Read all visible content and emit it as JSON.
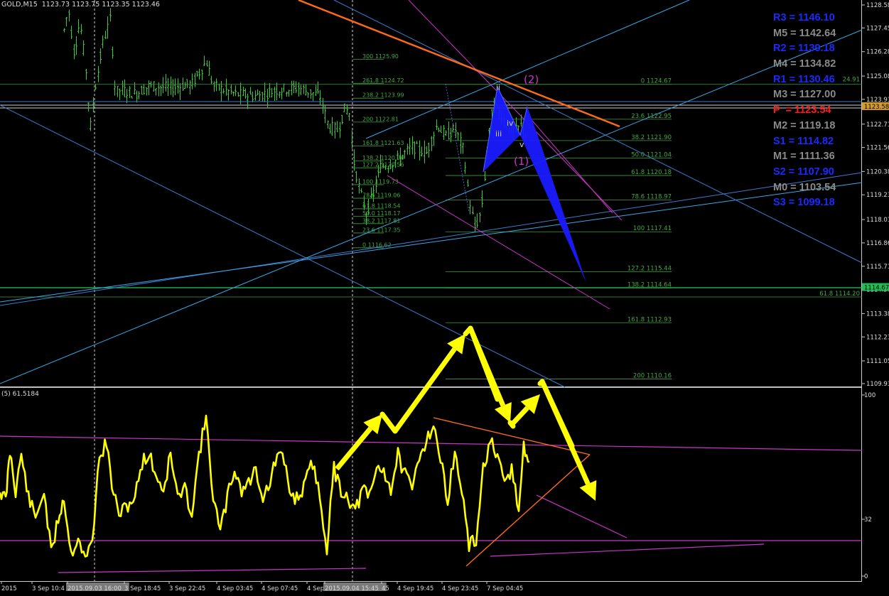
{
  "header": {
    "symbol": "GOLD,M15",
    "ohlc": "1123.73 1123.75 1123.35 1123.46"
  },
  "indicator": {
    "label": "(5) 61.5184"
  },
  "price_axis": {
    "ticks": [
      "1128.58",
      "1127.45",
      "1126.28",
      "1125.08",
      "1123.93",
      "1122.71",
      "1121.56",
      "1120.38",
      "1119.23",
      "1118.01",
      "1116.86",
      "1115.71",
      "1114.56",
      "1113.38",
      "1112.23",
      "1111.05",
      "1109.93"
    ],
    "current_price": "1123.58",
    "marked_price": "1114.67",
    "current_color": "#d29a2a",
    "marked_color": "#22bb55"
  },
  "indicator_axis": {
    "ticks": [
      "100",
      "32",
      "0"
    ]
  },
  "time_axis": {
    "labels": [
      "2015",
      "3 Sep 10:4",
      "2015.09.03 16:00",
      "3 Sep 18:45",
      "3 Sep 22:45",
      "4 Sep 03:45",
      "4 Sep 07:45",
      "4 Sep",
      "2015.09.04 15:45",
      "45",
      "4 Sep 19:45",
      "4 Sep 23:45",
      "7 Sep 04:45"
    ]
  },
  "pivot_levels": [
    {
      "name": "R3",
      "value": "1146.10",
      "color": "#1a2aff"
    },
    {
      "name": "M5",
      "value": "1142.64",
      "color": "#8a8a8a"
    },
    {
      "name": "R2",
      "value": "1139.18",
      "color": "#1a2aff"
    },
    {
      "name": "M4",
      "value": "1134.82",
      "color": "#8a8a8a"
    },
    {
      "name": "R1",
      "value": "1130.46",
      "color": "#1a2aff"
    },
    {
      "name": "M3",
      "value": "1127.00",
      "color": "#8a8a8a"
    },
    {
      "name": "P ",
      "value": "1123.54",
      "color": "#ff1a1a"
    },
    {
      "name": "M2",
      "value": "1119.18",
      "color": "#8a8a8a"
    },
    {
      "name": "S1",
      "value": "1114.82",
      "color": "#1a2aff"
    },
    {
      "name": "M1",
      "value": "1111.36",
      "color": "#8a8a8a"
    },
    {
      "name": "S2",
      "value": "1107.90",
      "color": "#1a2aff"
    },
    {
      "name": "M0",
      "value": "1103.54",
      "color": "#8a8a8a"
    },
    {
      "name": "S3",
      "value": "1099.18",
      "color": "#1a2aff"
    }
  ],
  "fib_left": [
    "300 1125.90",
    "261.8 1124.72",
    "238.2 1123.99",
    "200 1122.81",
    "161.8 1121.63",
    "138.2 1120.90",
    "127.2 1120.56",
    "100 1119.73",
    "78.6 1119.06",
    "61.8 1118.54",
    "50.0 1118.17",
    "38.2 1117.81",
    "23.6 1117.35",
    "0 1116.62"
  ],
  "fib_right": [
    "0 1124.67",
    "23.6 1122.95",
    "38.2 1121.90",
    "50.0 1121.04",
    "61.8 1120.18",
    "78.6 1118.97",
    "100 1117.41",
    "127.2 1115.44",
    "138.2 1114.64",
    "161.8 1112.93",
    "200 1110.16"
  ],
  "fib_extra": [
    "61.8 1114.20",
    "24.91"
  ],
  "wave_labels": {
    "w1": "(1)",
    "w2": "(2)",
    "ii": "ii",
    "iii": "iii",
    "iv": "iv",
    "v": "v"
  },
  "colors": {
    "candles": "#33cc33",
    "fib": "#3f9f3f",
    "trend_blue": "#3c7cd0",
    "trend_cyan": "#3aa8e8",
    "trend_orange": "#ff6a1a",
    "magenta": "#cc33cc",
    "blue_fill": "#1a1aff",
    "yellow": "#ffff00",
    "grid": "#cfcfcf"
  }
}
